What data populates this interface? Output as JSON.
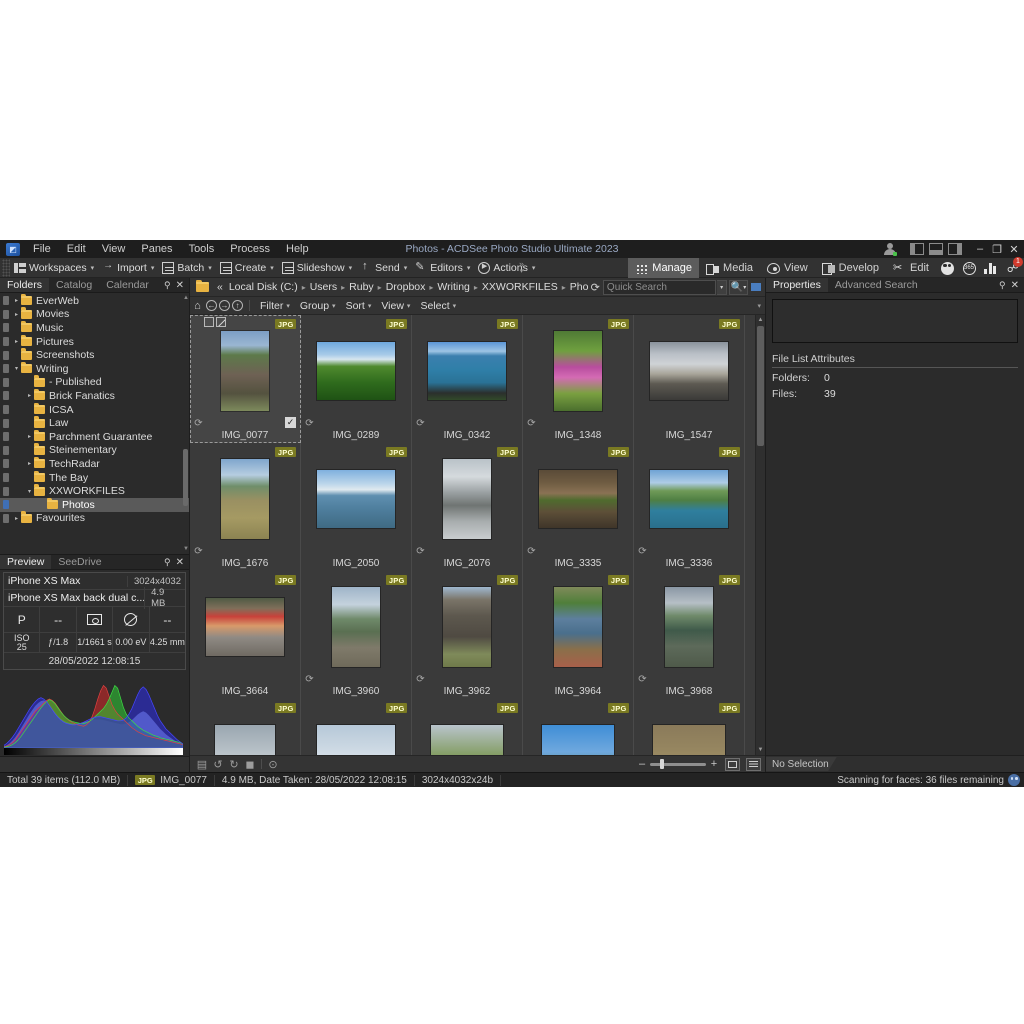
{
  "window": {
    "app_title": "Photos - ACDSee Photo Studio Ultimate 2023",
    "minimize": "–",
    "restore": "❐",
    "close": "✕"
  },
  "menubar": [
    "File",
    "Edit",
    "View",
    "Panes",
    "Tools",
    "Process",
    "Help"
  ],
  "toolbar": [
    {
      "label": "Workspaces",
      "icon": "workspaces-icon",
      "caret": "▾"
    },
    {
      "label": "Import",
      "icon": "import-icon",
      "caret": "▾"
    },
    {
      "label": "Batch",
      "icon": "batch-icon",
      "caret": "▾"
    },
    {
      "label": "Create",
      "icon": "create-icon",
      "caret": "▾"
    },
    {
      "label": "Slideshow",
      "icon": "slideshow-icon",
      "caret": "▾"
    },
    {
      "label": "Send",
      "icon": "send-icon",
      "caret": "▾"
    },
    {
      "label": "Editors",
      "icon": "editors-icon",
      "caret": "▾"
    },
    {
      "label": "Actions",
      "icon": "actions-icon",
      "caret": "▾"
    }
  ],
  "toolbar_overflow": "»",
  "modes": [
    {
      "label": "Manage",
      "icon": "grid-icon",
      "active": true
    },
    {
      "label": "Media",
      "icon": "media-icon",
      "active": false
    },
    {
      "label": "View",
      "icon": "eye-icon",
      "active": false
    },
    {
      "label": "Develop",
      "icon": "develop-icon",
      "active": false
    },
    {
      "label": "Edit",
      "icon": "scissors-icon",
      "active": false
    }
  ],
  "mode_icons": {
    "people": "people-icon",
    "online": "365-icon",
    "dashboard": "bar-chart-icon",
    "notifications": "notification-icon",
    "notification_count": "1"
  },
  "left_pane": {
    "tabs": [
      "Folders",
      "Catalog",
      "Calendar"
    ],
    "active_tab": "Folders",
    "pin": "⚲",
    "close": "✕",
    "tree": [
      {
        "label": "EverWeb",
        "indent": 0,
        "arrow": "▸",
        "selected": false
      },
      {
        "label": "Movies",
        "indent": 0,
        "arrow": "▸",
        "selected": false
      },
      {
        "label": "Music",
        "indent": 0,
        "arrow": "",
        "selected": false
      },
      {
        "label": "Pictures",
        "indent": 0,
        "arrow": "▸",
        "selected": false
      },
      {
        "label": "Screenshots",
        "indent": 0,
        "arrow": "",
        "selected": false
      },
      {
        "label": "Writing",
        "indent": 0,
        "arrow": "▾",
        "selected": false
      },
      {
        "label": "- Published",
        "indent": 1,
        "arrow": "",
        "selected": false
      },
      {
        "label": "Brick Fanatics",
        "indent": 1,
        "arrow": "▸",
        "selected": false
      },
      {
        "label": "ICSA",
        "indent": 1,
        "arrow": "",
        "selected": false
      },
      {
        "label": "Law",
        "indent": 1,
        "arrow": "",
        "selected": false
      },
      {
        "label": "Parchment Guarantee",
        "indent": 1,
        "arrow": "▸",
        "selected": false
      },
      {
        "label": "Steinementary",
        "indent": 1,
        "arrow": "",
        "selected": false
      },
      {
        "label": "TechRadar",
        "indent": 1,
        "arrow": "▸",
        "selected": false
      },
      {
        "label": "The Bay",
        "indent": 1,
        "arrow": "",
        "selected": false
      },
      {
        "label": "XXWORKFILES",
        "indent": 1,
        "arrow": "▾",
        "selected": false
      },
      {
        "label": "Photos",
        "indent": 2,
        "arrow": "",
        "selected": true
      },
      {
        "label": "Favourites",
        "indent": 0,
        "arrow": "▸",
        "selected": false
      }
    ]
  },
  "preview_pane": {
    "tabs": [
      "Preview",
      "SeeDrive"
    ],
    "active_tab": "Preview",
    "pin": "⚲",
    "close": "✕",
    "camera": "iPhone XS Max",
    "dimensions": "3024x4032",
    "lens": "iPhone XS Max back dual c...",
    "filesize": "4.9 MB",
    "mode_row": [
      "P",
      "--",
      "metering-icon",
      "flash-off-icon",
      "--"
    ],
    "exposure_row": [
      {
        "top": "ISO",
        "bottom": "25"
      },
      {
        "top": "",
        "bottom": "ƒ/1.8"
      },
      {
        "top": "",
        "bottom": "1/1661 s"
      },
      {
        "top": "",
        "bottom": "0.00 eV"
      },
      {
        "top": "",
        "bottom": "4.25 mm"
      }
    ],
    "date_taken": "28/05/2022 12:08:15"
  },
  "address_bar": {
    "folder_icon": "folder-icon",
    "prefix": "«",
    "crumbs": [
      "Local Disk (C:)",
      "Users",
      "Ruby",
      "Dropbox",
      "Writing",
      "XXWORKFILES",
      "Photos"
    ],
    "separator": "▸",
    "refresh_icon": "refresh-icon",
    "search_placeholder": "Quick Search",
    "search_value": "",
    "search_dropdown": "▾",
    "search_button": "search-icon",
    "filter_button": "funnel-icon"
  },
  "filter_bar": {
    "nav": [
      "home-icon",
      "back-icon",
      "forward-icon",
      "up-icon"
    ],
    "menus": [
      "Filter",
      "Group",
      "Sort",
      "View",
      "Select"
    ],
    "caret": "▾"
  },
  "thumbnails": [
    {
      "name": "IMG_0077",
      "format": "JPG",
      "selected": true,
      "portrait": true,
      "rotate": true
    },
    {
      "name": "IMG_0289",
      "format": "JPG",
      "selected": false,
      "portrait": false,
      "rotate": true
    },
    {
      "name": "IMG_0342",
      "format": "JPG",
      "selected": false,
      "portrait": false,
      "rotate": true
    },
    {
      "name": "IMG_1348",
      "format": "JPG",
      "selected": false,
      "portrait": true,
      "rotate": true
    },
    {
      "name": "IMG_1547",
      "format": "JPG",
      "selected": false,
      "portrait": false,
      "rotate": false
    },
    {
      "name": "IMG_1676",
      "format": "JPG",
      "selected": false,
      "portrait": true,
      "rotate": true
    },
    {
      "name": "IMG_2050",
      "format": "JPG",
      "selected": false,
      "portrait": false,
      "rotate": false
    },
    {
      "name": "IMG_2076",
      "format": "JPG",
      "selected": false,
      "portrait": true,
      "rotate": true
    },
    {
      "name": "IMG_3335",
      "format": "JPG",
      "selected": false,
      "portrait": false,
      "rotate": true
    },
    {
      "name": "IMG_3336",
      "format": "JPG",
      "selected": false,
      "portrait": false,
      "rotate": true
    },
    {
      "name": "IMG_3664",
      "format": "JPG",
      "selected": false,
      "portrait": false,
      "rotate": false
    },
    {
      "name": "IMG_3960",
      "format": "JPG",
      "selected": false,
      "portrait": true,
      "rotate": true
    },
    {
      "name": "IMG_3962",
      "format": "JPG",
      "selected": false,
      "portrait": true,
      "rotate": true
    },
    {
      "name": "IMG_3964",
      "format": "JPG",
      "selected": false,
      "portrait": true,
      "rotate": false
    },
    {
      "name": "IMG_3968",
      "format": "JPG",
      "selected": false,
      "portrait": true,
      "rotate": true
    }
  ],
  "thumbnails_partial": [
    {
      "format": "JPG"
    },
    {
      "format": "JPG"
    },
    {
      "format": "JPG"
    },
    {
      "format": "JPG"
    },
    {
      "format": "JPG"
    }
  ],
  "grid_bottom": {
    "icons": [
      "save-icon",
      "rotate-left-icon",
      "rotate-right-icon",
      "fill-icon",
      "next-icon"
    ],
    "minus": "–",
    "plus": "+",
    "view_thumb": "thumbnail-view-icon",
    "view_list": "list-view-icon"
  },
  "right_pane": {
    "tabs": [
      "Properties",
      "Advanced Search"
    ],
    "active_tab": "Properties",
    "pin": "⚲",
    "close": "✕",
    "section_title": "File List Attributes",
    "attributes": [
      {
        "key": "Folders:",
        "value": "0"
      },
      {
        "key": "Files:",
        "value": "39"
      }
    ],
    "bottom_tab": "No Selection"
  },
  "status_bar": {
    "total": "Total 39 items  (112.0 MB)",
    "format_tag": "JPG",
    "filename": "IMG_0077",
    "details": "4.9 MB, Date Taken: 28/05/2022 12:08:15",
    "resolution": "3024x4032x24b",
    "task": "Scanning for faces: 36 files remaining",
    "task_icon": "face-icon"
  },
  "colors": {
    "window_bg": "#2b2b2b",
    "grid_bg": "#3a3a3a",
    "accent_selected": "#5a5a5a",
    "folder_yellow": "#e8b341",
    "jpg_badge": "#7a7a22",
    "title_text": "#9aa9c4",
    "badge_red": "#d13b2e"
  },
  "histogram": {
    "bars": 64,
    "red": [
      2,
      3,
      5,
      8,
      12,
      18,
      24,
      30,
      36,
      42,
      48,
      54,
      58,
      62,
      66,
      70,
      72,
      70,
      66,
      60,
      54,
      48,
      44,
      40,
      38,
      36,
      34,
      33,
      32,
      34,
      38,
      46,
      58,
      72,
      84,
      92,
      88,
      76,
      64,
      56,
      50,
      46,
      42,
      38,
      34,
      30,
      27,
      24,
      22,
      20,
      18,
      17,
      16,
      15,
      14,
      13,
      12,
      11,
      10,
      9,
      8,
      7,
      6,
      5
    ],
    "green": [
      1,
      2,
      3,
      5,
      8,
      12,
      17,
      23,
      29,
      35,
      41,
      47,
      53,
      59,
      64,
      68,
      71,
      69,
      65,
      59,
      53,
      48,
      44,
      41,
      39,
      38,
      37,
      36,
      36,
      37,
      39,
      42,
      46,
      50,
      54,
      58,
      64,
      72,
      82,
      92,
      88,
      74,
      60,
      50,
      44,
      40,
      36,
      32,
      29,
      26,
      24,
      22,
      20,
      18,
      17,
      15,
      14,
      13,
      12,
      11,
      10,
      9,
      8,
      6
    ],
    "blue": [
      4,
      7,
      11,
      16,
      22,
      29,
      36,
      43,
      50,
      57,
      63,
      68,
      72,
      74,
      72,
      68,
      62,
      56,
      50,
      45,
      41,
      38,
      36,
      35,
      34,
      34,
      35,
      36,
      38,
      40,
      42,
      44,
      45,
      46,
      46,
      45,
      44,
      43,
      42,
      41,
      40,
      40,
      41,
      44,
      50,
      58,
      68,
      78,
      86,
      90,
      86,
      78,
      68,
      58,
      48,
      40,
      34,
      28,
      24,
      20,
      16,
      12,
      9,
      6
    ],
    "luma": [
      2,
      4,
      7,
      11,
      16,
      22,
      29,
      36,
      43,
      50,
      56,
      62,
      66,
      69,
      70,
      68,
      64,
      58,
      52,
      47,
      43,
      40,
      38,
      37,
      36,
      36,
      36,
      37,
      38,
      39,
      40,
      41,
      42,
      42,
      42,
      41,
      40,
      39,
      38,
      37,
      36,
      35,
      35,
      36,
      38,
      41,
      45,
      49,
      52,
      54,
      52,
      48,
      43,
      38,
      33,
      28,
      24,
      20,
      17,
      14,
      11,
      9,
      7,
      5
    ]
  }
}
